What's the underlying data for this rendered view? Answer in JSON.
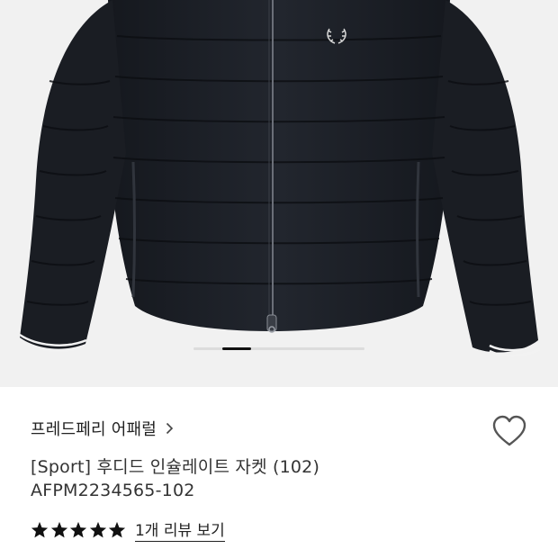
{
  "product": {
    "brand": "프레드페리 어패럴",
    "title": "[Sport] 후디드 인슐레이트 자켓 (102)",
    "code": "AFPM2234565-102",
    "rating_stars": 5,
    "review_link": "1개 리뷰 보기"
  },
  "gallery": {
    "active_index": 1,
    "image_alt": "black hooded insulated jacket"
  },
  "icons": {
    "brand": "chevron-right-icon",
    "wishlist": "heart-outline-icon",
    "rating": "star-icon"
  },
  "colors": {
    "jacket": "#1c1f26",
    "background": "#f1f1f1",
    "star": "#111111",
    "pager_active": "#111111"
  }
}
